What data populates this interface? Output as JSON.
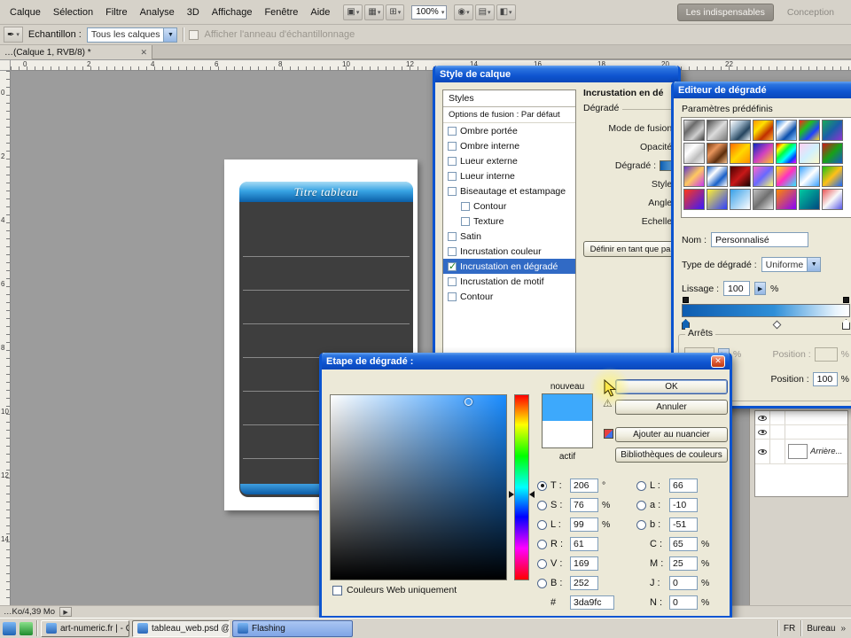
{
  "app": {
    "menu": [
      "Calque",
      "Sélection",
      "Filtre",
      "Analyse",
      "3D",
      "Affichage",
      "Fenêtre",
      "Aide"
    ],
    "toolbar_icons_left": [
      {
        "name": "bridge-icon",
        "glyph": "▣"
      },
      {
        "name": "view-extras-icon",
        "glyph": "▦"
      },
      {
        "name": "guides-grid-icon",
        "glyph": "⊞"
      }
    ],
    "zoom_level": "100%",
    "toolbar_icons_right": [
      {
        "name": "hand-tool-icon",
        "glyph": "◉"
      },
      {
        "name": "arrange-documents-icon",
        "glyph": "▤"
      },
      {
        "name": "screen-mode-icon",
        "glyph": "◧"
      }
    ],
    "workspaces": [
      {
        "label": "Les indispensables",
        "active": true
      },
      {
        "label": "Conception"
      }
    ],
    "options_bar": {
      "sample_label": "Echantillon :",
      "sample_value": "Tous les calques",
      "ring_label": "Afficher l'anneau d'échantillonnage"
    },
    "doc_tab": {
      "title": "…(Calque 1, RVB/8) *",
      "close": "✕"
    },
    "ruler_h": [
      "0",
      "2",
      "4",
      "6",
      "8",
      "10",
      "12",
      "14",
      "16",
      "18",
      "20",
      "22"
    ],
    "ruler_v": [
      "0",
      "2",
      "4",
      "6",
      "8",
      "10",
      "12",
      "14"
    ],
    "status_text": "…Ko/4,39 Mo"
  },
  "canvas": {
    "table_title": "Titre tableau"
  },
  "layer_style_dialog": {
    "title": "Style de calque",
    "styles_header": "Styles",
    "blend_options": "Options de fusion : Par défaut",
    "items": [
      {
        "label": "Ombre portée"
      },
      {
        "label": "Ombre interne"
      },
      {
        "label": "Lueur externe"
      },
      {
        "label": "Lueur interne"
      },
      {
        "label": "Biseautage et estampage"
      },
      {
        "label": "Contour",
        "indent": true
      },
      {
        "label": "Texture",
        "indent": true
      },
      {
        "label": "Satin"
      },
      {
        "label": "Incrustation couleur"
      },
      {
        "label": "Incrustation en dégradé",
        "checked": true,
        "selected": true
      },
      {
        "label": "Incrustation de motif"
      },
      {
        "label": "Contour"
      }
    ],
    "right": {
      "section_title": "Incrustation en dé",
      "group_label": "Dégradé",
      "fields": [
        {
          "label": "Mode de fusion :"
        },
        {
          "label": "Opacité :"
        },
        {
          "label": "Dégradé :",
          "chip": true
        },
        {
          "label": "Style :"
        },
        {
          "label": "Angle :"
        },
        {
          "label": "Echelle :"
        }
      ],
      "define_button": "Définir en tant que pa"
    }
  },
  "gradient_editor": {
    "title": "Editeur de dégradé",
    "presets_label": "Paramètres prédéfinis",
    "name_label": "Nom :",
    "name_value": "Personnalisé",
    "type_label": "Type de dégradé :",
    "type_value": "Uniforme",
    "smooth_label": "Lissage :",
    "smooth_value": "100",
    "percent": "%",
    "stops_label": "Arrêts",
    "position_label": "Position :",
    "position_value": "100",
    "swatches": [
      {
        "colors": [
          "#e8e8e8",
          "#6a6a6a",
          "#cfcfcf",
          "#3f3f3f"
        ]
      },
      {
        "colors": [
          "#4a4a4a",
          "#dcdcdc",
          "#7a7a7a"
        ]
      },
      {
        "colors": [
          "#ffffff",
          "#9fb6c8",
          "#25455f",
          "#e8f2f8"
        ]
      },
      {
        "colors": [
          "#ff9500",
          "#ffe000",
          "#c03000",
          "#ffb030"
        ]
      },
      {
        "colors": [
          "#1a78e0",
          "#ffffff",
          "#0a4fae",
          "#8fc8ff"
        ]
      },
      {
        "colors": [
          "#ff2020",
          "#20c020",
          "#2040ff",
          "#ffe020"
        ]
      },
      {
        "colors": [
          "#18a85a",
          "#1a5fa8",
          "#8f35d0"
        ]
      },
      {
        "colors": [
          "#d8d8d8",
          "#ffffff",
          "#bdbdbd",
          "#f4f4f4"
        ]
      },
      {
        "colors": [
          "#7a3b10",
          "#e8955c",
          "#5c2d0c",
          "#f7c08a"
        ]
      },
      {
        "colors": [
          "#ff6a00",
          "#ffd800",
          "#ff8c00"
        ]
      },
      {
        "colors": [
          "#0a28c0",
          "#d040c0",
          "#ffc820"
        ]
      },
      {
        "colors": [
          "#ff0000",
          "#ffff00",
          "#00ff40",
          "#00ffff",
          "#0040ff",
          "#ff00ff"
        ]
      },
      {
        "colors": [
          "#ffd0f0",
          "#d0f0ff",
          "#fff8c8"
        ]
      },
      {
        "colors": [
          "#d01818",
          "#18a018",
          "#1858c8"
        ]
      },
      {
        "colors": [
          "#6038c8",
          "#ffc860",
          "#c838f0"
        ]
      },
      {
        "colors": [
          "#1860c8",
          "#ffffff",
          "#1860c8",
          "#ffffff"
        ]
      },
      {
        "colors": [
          "#480000",
          "#c81818",
          "#180000"
        ]
      },
      {
        "colors": [
          "#ff68c8",
          "#6868ff",
          "#ffff68"
        ]
      },
      {
        "colors": [
          "#ffe800",
          "#ff30c0",
          "#30e8ff"
        ]
      },
      {
        "colors": [
          "#38a0ff",
          "#ffffff",
          "#38a0ff"
        ]
      },
      {
        "colors": [
          "#18c018",
          "#ffc018",
          "#1868ff"
        ]
      },
      {
        "colors": [
          "#ff3818",
          "#3818ff"
        ]
      },
      {
        "colors": [
          "#fff030",
          "#3040ff"
        ]
      },
      {
        "colors": [
          "#38a0e8",
          "#ffffff"
        ]
      },
      {
        "colors": [
          "#c0c0c0",
          "#707070",
          "#e8e8e8"
        ]
      },
      {
        "colors": [
          "#ff8800",
          "#8800ff"
        ]
      },
      {
        "colors": [
          "#00c8a0",
          "#004880"
        ]
      },
      {
        "colors": [
          "#e85858",
          "#f8f8f8",
          "#5858e8"
        ]
      }
    ]
  },
  "color_picker": {
    "title": "Etape de dégradé :",
    "close": "✕",
    "new_label": "nouveau",
    "current_label": "actif",
    "buttons": [
      {
        "label": "OK",
        "default": true
      },
      {
        "label": "Annuler"
      },
      {
        "label": "Ajouter au nuancier"
      },
      {
        "label": "Bibliothèques de couleurs"
      }
    ],
    "hsb": [
      {
        "key": "T :",
        "value": "206",
        "unit": "°",
        "radio": true,
        "selected": true
      },
      {
        "key": "S :",
        "value": "76",
        "unit": "%",
        "radio": true
      },
      {
        "key": "L :",
        "value": "99",
        "unit": "%",
        "radio": true
      }
    ],
    "rgb": [
      {
        "key": "R :",
        "value": "61",
        "radio": true
      },
      {
        "key": "V :",
        "value": "169",
        "radio": true
      },
      {
        "key": "B :",
        "value": "252",
        "radio": true
      }
    ],
    "lab": [
      {
        "key": "L :",
        "value": "66",
        "radio": true
      },
      {
        "key": "a :",
        "value": "-10",
        "radio": true
      },
      {
        "key": "b :",
        "value": "-51",
        "radio": true
      }
    ],
    "cmyk": [
      {
        "key": "C :",
        "value": "65",
        "unit": "%"
      },
      {
        "key": "M :",
        "value": "25",
        "unit": "%"
      },
      {
        "key": "J :",
        "value": "0",
        "unit": "%"
      },
      {
        "key": "N :",
        "value": "0",
        "unit": "%"
      }
    ],
    "hex_label": "#",
    "hex_value": "3da9fc",
    "web_only_label": "Couleurs Web uniquement",
    "colors": {
      "new": "#3da9fc",
      "current": "#ffffff"
    }
  },
  "layers_panel": {
    "layer_name": "Arrière..."
  },
  "taskbar": {
    "buttons": [
      {
        "label": "art-numeric.fr | - Goo..."
      },
      {
        "label": "tableau_web.psd @ ...",
        "active": true
      },
      {
        "label": "Flashing",
        "flash": true
      }
    ],
    "lang": "FR",
    "desktop_label": "Bureau",
    "chevron": "»"
  }
}
